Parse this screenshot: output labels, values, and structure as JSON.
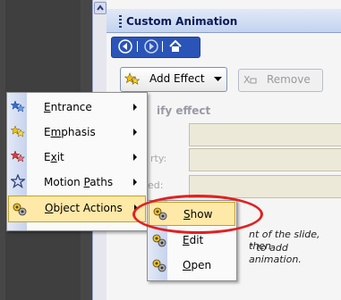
{
  "task_pane": {
    "title": "Custom Animation",
    "add_effect_label": "Add Effect",
    "remove_label": "Remove",
    "modify_heading": "ify effect",
    "field_labels": [
      "rty:",
      "ed:"
    ],
    "hint_line1": "nt of the slide, then",
    "hint_line2": "\" to add animation."
  },
  "add_effect_menu": {
    "items": [
      {
        "label": "Entrance",
        "accel": "E",
        "icon": "entrance-star-icon"
      },
      {
        "label": "Emphasis",
        "accel": "m",
        "icon": "emphasis-star-icon"
      },
      {
        "label": "Exit",
        "accel": "x",
        "icon": "exit-star-icon"
      },
      {
        "label": "Motion Paths",
        "accel": "P",
        "icon": "motion-path-star-icon"
      },
      {
        "label": "Object Actions",
        "accel": "O",
        "icon": "object-actions-icon"
      }
    ]
  },
  "object_actions_submenu": {
    "items": [
      {
        "label": "Show",
        "accel": "S"
      },
      {
        "label": "Edit",
        "accel": "E"
      },
      {
        "label": "Open",
        "accel": "O"
      }
    ]
  },
  "colors": {
    "menu_highlight": "#ffe9a8",
    "annotation": "#e02121",
    "nav_bar": "#2a54b8"
  }
}
